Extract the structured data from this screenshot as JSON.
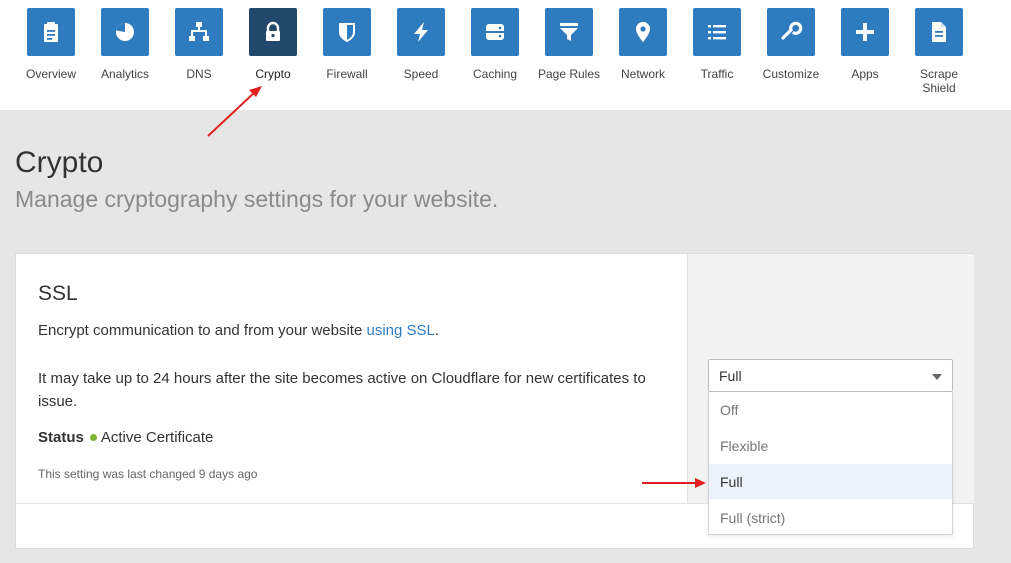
{
  "nav": {
    "items": [
      {
        "key": "overview",
        "label": "Overview",
        "icon": "clipboard-icon"
      },
      {
        "key": "analytics",
        "label": "Analytics",
        "icon": "pie-chart-icon"
      },
      {
        "key": "dns",
        "label": "DNS",
        "icon": "network-tree-icon"
      },
      {
        "key": "crypto",
        "label": "Crypto",
        "icon": "lock-icon",
        "active": true
      },
      {
        "key": "firewall",
        "label": "Firewall",
        "icon": "shield-icon"
      },
      {
        "key": "speed",
        "label": "Speed",
        "icon": "lightning-icon"
      },
      {
        "key": "caching",
        "label": "Caching",
        "icon": "server-icon"
      },
      {
        "key": "page-rules",
        "label": "Page Rules",
        "icon": "filter-icon"
      },
      {
        "key": "network",
        "label": "Network",
        "icon": "map-pin-icon"
      },
      {
        "key": "traffic",
        "label": "Traffic",
        "icon": "list-icon"
      },
      {
        "key": "customize",
        "label": "Customize",
        "icon": "wrench-icon"
      },
      {
        "key": "apps",
        "label": "Apps",
        "icon": "plus-icon"
      },
      {
        "key": "scrape-shield",
        "label": "Scrape Shield",
        "icon": "document-icon"
      }
    ]
  },
  "page": {
    "title": "Crypto",
    "subtitle": "Manage cryptography settings for your website."
  },
  "ssl": {
    "title": "SSL",
    "description": "Encrypt communication to and from your website",
    "description_link": "using SSL",
    "description_end": ".",
    "note": "It may take up to 24 hours after the site becomes active on Cloudflare for new certificates to issue.",
    "status_label": "Status",
    "status_value": "Active Certificate",
    "last_changed": "This setting was last changed 9 days ago",
    "select": {
      "value": "Full",
      "options": [
        "Off",
        "Flexible",
        "Full",
        "Full (strict)"
      ],
      "highlighted": "Full"
    }
  },
  "colors": {
    "nav_tile": "#2f7bbf",
    "nav_tile_active": "#23486e",
    "link": "#2f7bbf",
    "status_dot": "#7fb435",
    "annotation_arrow": "#e02020",
    "option_highlight": "#eaf3fb"
  }
}
